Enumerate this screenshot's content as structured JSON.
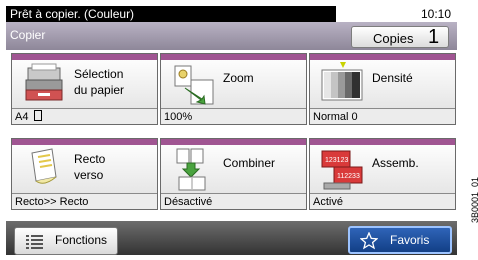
{
  "status": {
    "message": "Prêt à copier. (Couleur)",
    "time": "10:10"
  },
  "header": {
    "title": "Copier",
    "copies_label": "Copies",
    "copies_value": "1"
  },
  "tiles": [
    {
      "line1": "Sélection",
      "line2": "du papier",
      "value": "A4",
      "icon": "paper-tray-icon"
    },
    {
      "line1": "Zoom",
      "line2": "",
      "value": "100%",
      "icon": "zoom-icon"
    },
    {
      "line1": "Densité",
      "line2": "",
      "value": "Normal 0",
      "icon": "density-icon"
    },
    {
      "line1": "Recto",
      "line2": "verso",
      "value": "Recto>> Recto",
      "icon": "duplex-icon"
    },
    {
      "line1": "Combiner",
      "line2": "",
      "value": "Désactivé",
      "icon": "combine-icon"
    },
    {
      "line1": "Assemb.",
      "line2": "",
      "value": "Activé",
      "icon": "collate-icon",
      "pages": [
        "123123",
        "112233"
      ]
    }
  ],
  "bottom": {
    "functions_label": "Fonctions",
    "favorites_label": "Favoris"
  },
  "side_code": "3B0001_01",
  "colors": {
    "accent": "#a05592",
    "favorites": "#1b4ea0"
  }
}
